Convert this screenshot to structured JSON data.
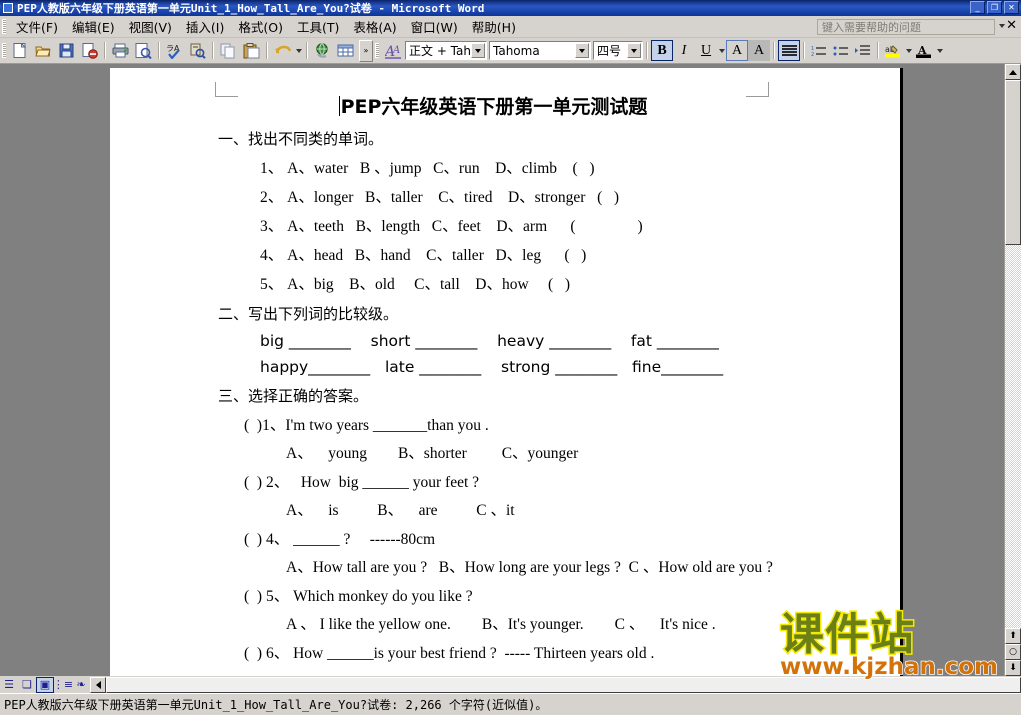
{
  "window": {
    "title": "PEP人教版六年级下册英语第一单元Unit_1_How_Tall_Are_You?试卷 - Microsoft Word",
    "icon": "word-document-icon",
    "minimize": "_",
    "maximize": "❐",
    "close": "✕"
  },
  "menu": {
    "items": [
      {
        "label": "文件(F)"
      },
      {
        "label": "编辑(E)"
      },
      {
        "label": "视图(V)"
      },
      {
        "label": "插入(I)"
      },
      {
        "label": "格式(O)"
      },
      {
        "label": "工具(T)"
      },
      {
        "label": "表格(A)"
      },
      {
        "label": "窗口(W)"
      },
      {
        "label": "帮助(H)"
      }
    ],
    "help_placeholder": "键入需要帮助的问题",
    "close_label": "✕"
  },
  "toolbar": {
    "standard": [
      {
        "name": "new-document-icon"
      },
      {
        "name": "open-folder-icon"
      },
      {
        "name": "save-icon"
      },
      {
        "name": "permission-icon"
      },
      {
        "name": "print-icon"
      },
      {
        "name": "print-preview-icon"
      },
      {
        "name": "spelling-check-icon"
      },
      {
        "name": "research-icon"
      },
      {
        "name": "copy-icon"
      },
      {
        "name": "paste-icon"
      },
      {
        "name": "undo-icon"
      },
      {
        "name": "insert-hyperlink-icon"
      },
      {
        "name": "insert-table-icon"
      }
    ],
    "overflow_label": "»",
    "style_value": "正文 + Tahc",
    "font_value": "Tahoma",
    "size_value": "四号",
    "bold_label": "B",
    "italic_label": "I",
    "underline_label": "U",
    "font_grow_label": "A",
    "font_shrink_label": "A",
    "align_label": "≡",
    "numbering_label": "≡",
    "bullets_label": "≣",
    "indent_label": "⇥",
    "highlight_label": "ab",
    "fontcolor_label": "A"
  },
  "document": {
    "title_caret": "",
    "title_bold": "PEP",
    "title_rest": "六年级英语下册第一单元测试题",
    "section1_heading": "一、找出不同类的单词。",
    "section1_questions": [
      "1、 A、water   B 、jump   C、run    D、climb    (   )",
      "2、 A、longer   B、taller    C、tired    D、stronger   (   )",
      "3、 A、teeth   B、length   C、feet    D、arm      (                )",
      "4、 A、head   B、hand    C、taller   D、leg      (   )",
      "5、 A、big    B、old     C、tall    D、how     (   )"
    ],
    "section2_heading": "二、写出下列词的比较级。",
    "section2_rows": [
      "big ________    short ________    heavy ________    fat ________",
      "happy________   late ________    strong ________   fine________"
    ],
    "section3_heading": "三、选择正确的答案。",
    "section3_items": [
      {
        "q": "(  )1、I'm two years _______than you .",
        "opts": "A、    young        B、shorter         C、younger"
      },
      {
        "q": "(  ) 2、   How  big ______ your feet ?",
        "opts": "A、    is          B、    are          C 、it"
      },
      {
        "q": "(  ) 4、 ______ ?     ------80cm",
        "opts": "A、How tall are you ?   B、How long are your legs ?  C 、How old are you ?"
      },
      {
        "q": "(  ) 5、 Which monkey do you like ?",
        "opts": "A 、 I like the yellow one.        B、It's younger.        C 、    It's nice ."
      },
      {
        "q": "(  ) 6、 How ______is your best friend ?  ----- Thirteen years old .",
        "opts": ""
      }
    ]
  },
  "watermark": {
    "text_cn": "课件站",
    "text_url": "www.kjzhan.com",
    "color_cn": "#6b7f17",
    "color_outline": "#f5ea00",
    "color_url": "#d4720a"
  },
  "view_buttons": [
    {
      "name": "normal-view-button",
      "label": "☰"
    },
    {
      "name": "web-layout-view-button",
      "label": "❏"
    },
    {
      "name": "print-layout-view-button",
      "label": "▣"
    },
    {
      "name": "outline-view-button",
      "label": "⋮≡"
    },
    {
      "name": "reading-layout-view-button",
      "label": "❧"
    }
  ],
  "statusbar": {
    "text": "PEP人教版六年级下册英语第一单元Unit_1_How_Tall_Are_You?试卷: 2,266 个字符(近似值)。"
  },
  "scrollbars": {
    "up_arrow": "▲",
    "down_arrow": "▼",
    "prev_page": "⬆",
    "select_object": "○",
    "next_page": "⬇",
    "left_arrow": "◀"
  }
}
